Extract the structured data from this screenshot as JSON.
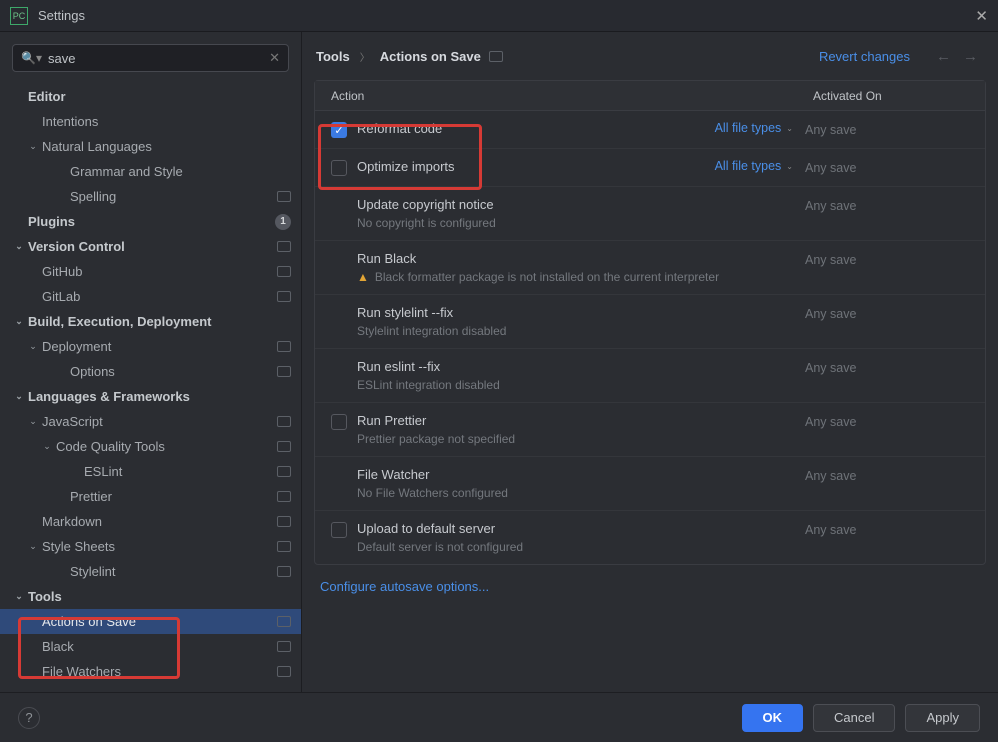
{
  "title": "Settings",
  "search": {
    "value": "save"
  },
  "sidebar": [
    {
      "label": "Editor",
      "depth": 0,
      "bold": true
    },
    {
      "label": "Intentions",
      "depth": 1
    },
    {
      "label": "Natural Languages",
      "depth": 1,
      "chevron": true
    },
    {
      "label": "Grammar and Style",
      "depth": 3
    },
    {
      "label": "Spelling",
      "depth": 3,
      "tag": true
    },
    {
      "label": "Plugins",
      "depth": 0,
      "bold": true,
      "badge": "1"
    },
    {
      "label": "Version Control",
      "depth": 0,
      "bold": true,
      "chevron": true,
      "tag": true
    },
    {
      "label": "GitHub",
      "depth": 1,
      "tag": true
    },
    {
      "label": "GitLab",
      "depth": 1,
      "tag": true
    },
    {
      "label": "Build, Execution, Deployment",
      "depth": 0,
      "bold": true,
      "chevron": true
    },
    {
      "label": "Deployment",
      "depth": 1,
      "chevron": true,
      "tag": true
    },
    {
      "label": "Options",
      "depth": 3,
      "tag": true
    },
    {
      "label": "Languages & Frameworks",
      "depth": 0,
      "bold": true,
      "chevron": true
    },
    {
      "label": "JavaScript",
      "depth": 1,
      "chevron": true,
      "tag": true
    },
    {
      "label": "Code Quality Tools",
      "depth": 2,
      "chevron": true,
      "tag": true
    },
    {
      "label": "ESLint",
      "depth": 4,
      "tag": true
    },
    {
      "label": "Prettier",
      "depth": 3,
      "tag": true
    },
    {
      "label": "Markdown",
      "depth": 1,
      "tag": true
    },
    {
      "label": "Style Sheets",
      "depth": 1,
      "chevron": true,
      "tag": true
    },
    {
      "label": "Stylelint",
      "depth": 3,
      "tag": true
    },
    {
      "label": "Tools",
      "depth": 0,
      "bold": true,
      "chevron": true
    },
    {
      "label": "Actions on Save",
      "depth": 1,
      "selected": true,
      "tag": true
    },
    {
      "label": "Black",
      "depth": 1,
      "tag": true
    },
    {
      "label": "File Watchers",
      "depth": 1,
      "tag": true
    }
  ],
  "breadcrumb": {
    "root": "Tools",
    "current": "Actions on Save"
  },
  "revert_label": "Revert changes",
  "columns": {
    "action": "Action",
    "activated": "Activated On"
  },
  "rows": [
    {
      "checkbox": "checked",
      "title": "Reformat code",
      "scope": "All file types",
      "activated": "Any save"
    },
    {
      "checkbox": "unchecked",
      "title": "Optimize imports",
      "scope": "All file types",
      "activated": "Any save"
    },
    {
      "title": "Update copyright notice",
      "sub": "No copyright is configured",
      "activated": "Any save"
    },
    {
      "title": "Run Black",
      "sub": "Black formatter package is not installed on the current interpreter",
      "warn": true,
      "activated": "Any save"
    },
    {
      "title": "Run stylelint --fix",
      "sub": "Stylelint integration disabled",
      "activated": "Any save"
    },
    {
      "title": "Run eslint --fix",
      "sub": "ESLint integration disabled",
      "activated": "Any save"
    },
    {
      "checkbox": "unchecked",
      "title": "Run Prettier",
      "sub": "Prettier package not specified",
      "activated": "Any save"
    },
    {
      "title": "File Watcher",
      "sub": "No File Watchers configured",
      "activated": "Any save"
    },
    {
      "checkbox": "unchecked",
      "title": "Upload to default server",
      "sub": "Default server is not configured",
      "activated": "Any save"
    }
  ],
  "configure_link": "Configure autosave options...",
  "buttons": {
    "ok": "OK",
    "cancel": "Cancel",
    "apply": "Apply"
  }
}
